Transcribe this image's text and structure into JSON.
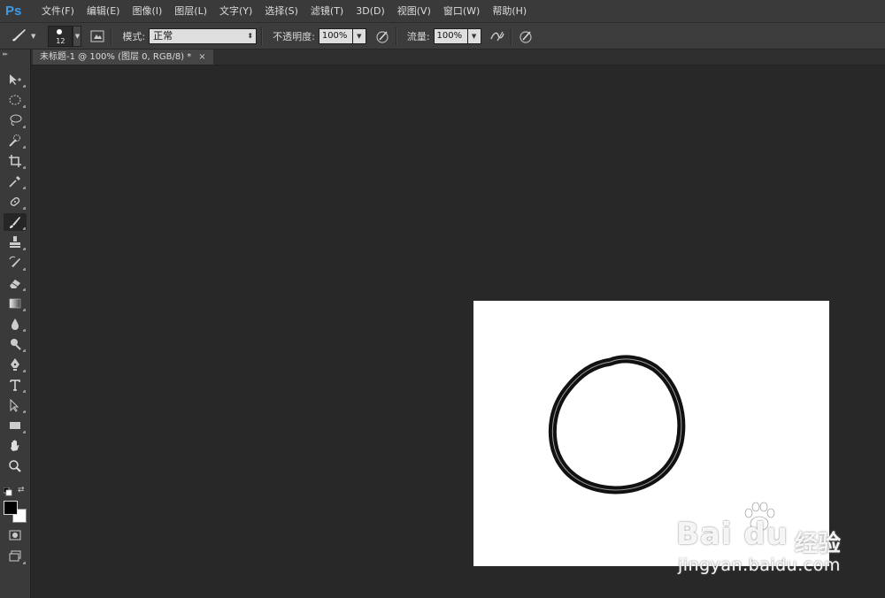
{
  "app": {
    "logo": "Ps"
  },
  "menu": [
    "文件(F)",
    "编辑(E)",
    "图像(I)",
    "图层(L)",
    "文字(Y)",
    "选择(S)",
    "滤镜(T)",
    "3D(D)",
    "视图(V)",
    "窗口(W)",
    "帮助(H)"
  ],
  "options": {
    "tool_icon": "brush-icon",
    "brush_size": "12",
    "mode_label": "模式:",
    "mode_value": "正常",
    "opacity_label": "不透明度:",
    "opacity_value": "100%",
    "flow_label": "流量:",
    "flow_value": "100%"
  },
  "document": {
    "tab_title": "未标题-1 @ 100% (图层 0, RGB/8) *",
    "close_glyph": "×"
  },
  "tools": [
    "move",
    "marquee",
    "lasso",
    "quick-select",
    "crop",
    "eyedropper",
    "healing",
    "brush",
    "stamp",
    "history-brush",
    "eraser",
    "gradient",
    "blur",
    "dodge",
    "pen",
    "type",
    "path-select",
    "rectangle",
    "hand",
    "zoom"
  ],
  "colors": {
    "foreground": "#000000",
    "background": "#ffffff",
    "accent": "#3b9be8"
  },
  "watermark": {
    "logo": "Bai du",
    "cn": "经验",
    "url": "jingyan.baidu.com"
  }
}
